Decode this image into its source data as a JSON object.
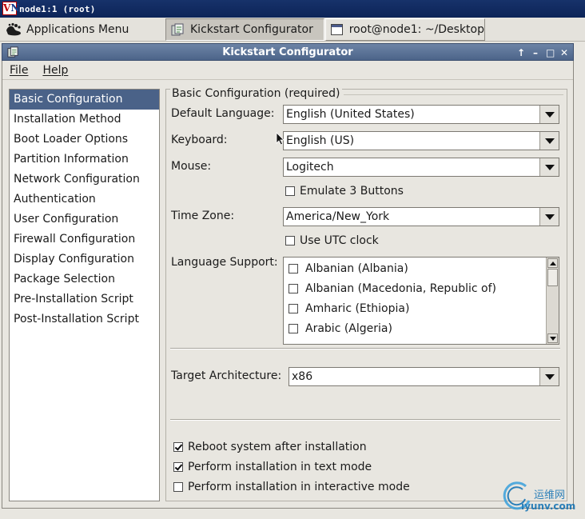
{
  "vnc": {
    "title": "node1:1 (root)",
    "logo_v": "V",
    "logo_n": "N"
  },
  "panel": {
    "apps_menu_label": "Applications Menu",
    "tasks": [
      {
        "label": "Kickstart Configurator",
        "icon": "kickstart-icon",
        "active": true
      },
      {
        "label": "root@node1: ~/Desktop",
        "icon": "terminal-icon",
        "active": false
      }
    ]
  },
  "window": {
    "title": "Kickstart Configurator",
    "controls": [
      "↑",
      "–",
      "□",
      "✕"
    ]
  },
  "menubar": {
    "items": [
      "File",
      "Help"
    ]
  },
  "sidebar": {
    "items": [
      "Basic Configuration",
      "Installation Method",
      "Boot Loader Options",
      "Partition Information",
      "Network Configuration",
      "Authentication",
      "User Configuration",
      "Firewall Configuration",
      "Display Configuration",
      "Package Selection",
      "Pre-Installation Script",
      "Post-Installation Script"
    ],
    "selected_index": 0
  },
  "basic": {
    "section_title": "Basic Configuration (required)",
    "default_language": {
      "label": "Default Language:",
      "value": "English (United States)"
    },
    "keyboard": {
      "label": "Keyboard:",
      "value": "English (US)"
    },
    "mouse": {
      "label": "Mouse:",
      "value": "Logitech"
    },
    "emulate_3_buttons": {
      "label": "Emulate 3 Buttons",
      "checked": false
    },
    "time_zone": {
      "label": "Time Zone:",
      "value": "America/New_York"
    },
    "use_utc_clock": {
      "label": "Use UTC clock",
      "checked": false
    },
    "language_support": {
      "label": "Language Support:",
      "items": [
        "Albanian (Albania)",
        "Albanian (Macedonia, Republic of)",
        "Amharic (Ethiopia)",
        "Arabic (Algeria)"
      ]
    },
    "target_architecture": {
      "label": "Target Architecture:",
      "value": "x86"
    },
    "options": [
      {
        "label": "Reboot system after installation",
        "checked": true
      },
      {
        "label": "Perform installation in text mode",
        "checked": true
      },
      {
        "label": "Perform installation in interactive mode",
        "checked": false
      }
    ]
  },
  "watermark": {
    "cn": "运维网",
    "en": "iyunv.com"
  },
  "colors": {
    "selection": "#4a6288",
    "titlebar": "#5a7296",
    "vnc_bar": "#0c2458",
    "watermark": "#0d6fb3"
  }
}
